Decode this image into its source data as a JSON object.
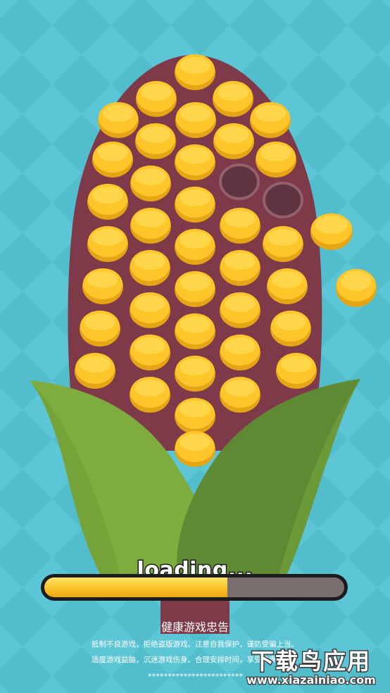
{
  "game": {
    "loading_text": "loading...",
    "progress": 0.61
  },
  "notice": {
    "title": "健康游戏忠告",
    "line1": "抵制不良游戏，拒绝盗版游戏。注意自我保护，谨防受骗上当。",
    "line2": "适度游戏益脑，沉迷游戏伤身。合理安排时间，享受健康生活。",
    "stars": "************************"
  },
  "watermark": {
    "title": "下载鸟应用",
    "url": "www.xiazainiao.com"
  },
  "colors": {
    "background": "#5cc6d6",
    "diamond": "#4fb9ca",
    "cob": "#7e3a48",
    "kernel": "#ffc62a",
    "husk_light": "#7fac3e",
    "husk_dark": "#5f8a33",
    "bar_fill": "#f7c326",
    "bar_empty": "#7a6e6e"
  }
}
